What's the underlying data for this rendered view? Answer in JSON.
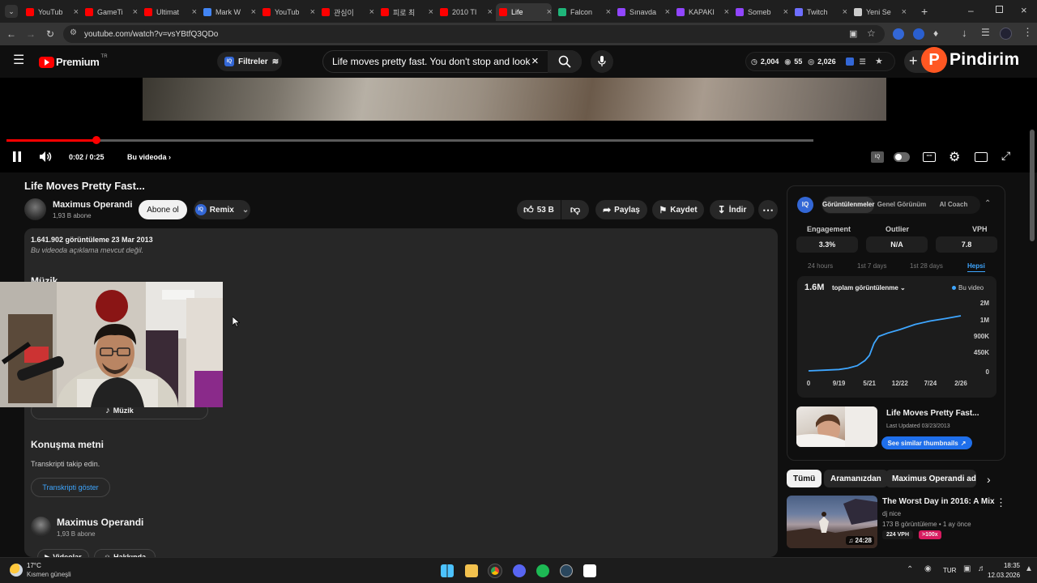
{
  "browser": {
    "tabs": [
      {
        "label": "YouTub",
        "color": "#ff0000"
      },
      {
        "label": "GameTi",
        "color": "#ff0000"
      },
      {
        "label": "Ultimat",
        "color": "#ff0000"
      },
      {
        "label": "Mark W",
        "color": "#4285f4"
      },
      {
        "label": "YouTub",
        "color": "#ff0000"
      },
      {
        "label": "관심이",
        "color": "#ff0000"
      },
      {
        "label": "피로 최",
        "color": "#ff0000"
      },
      {
        "label": "2010 TI",
        "color": "#ff0000"
      },
      {
        "label": "Life",
        "color": "#ff0000",
        "active": true
      },
      {
        "label": "Falcon",
        "color": "#1fb67a"
      },
      {
        "label": "Sınavda",
        "color": "#9146ff"
      },
      {
        "label": "KAPAKI",
        "color": "#9146ff"
      },
      {
        "label": "Someb",
        "color": "#9146ff"
      },
      {
        "label": "Twitch",
        "color": "#6e6eff"
      },
      {
        "label": "Yeni Se",
        "color": "#cccccc"
      }
    ],
    "url": "youtube.com/watch?v=vsYBtfQ3QDo"
  },
  "yt_header": {
    "logo": "Premium",
    "logo_region": "TR",
    "filters_label": "Filtreler",
    "search_value": "Life moves pretty fast. You don't stop and look aroun",
    "stats": [
      "2,004",
      "55",
      "2,026"
    ],
    "overlay_brand": "Pindirim"
  },
  "player": {
    "time": "0:02 / 0:25",
    "chapter": "Bu videoda",
    "progress_fraction": 0.111,
    "buffer_fraction": 1.0
  },
  "video": {
    "title": "Life Moves Pretty Fast...",
    "channel": "Maximus Operandi",
    "subscribers": "1,93 B abone",
    "subscribe_label": "Abone ol",
    "remix_label": "Remix",
    "likes": "53 B",
    "share_label": "Paylaş",
    "save_label": "Kaydet",
    "download_label": "İndir"
  },
  "description": {
    "views_date": "1.641.902 görüntüleme  23 Mar 2013",
    "no_desc": "Bu videoda açıklama mevcut değil.",
    "music_heading": "Müzik",
    "music_button": "Müzik",
    "transcript_heading": "Konuşma metni",
    "transcript_sub": "Transkripti takip edin.",
    "transcript_button": "Transkripti göster",
    "channel_name": "Maximus Operandi",
    "channel_subs": "1,93 B abone",
    "videos_button": "Videolar",
    "about_button": "Hakkında"
  },
  "iq_panel": {
    "tabs": [
      "Görüntülenmeler",
      "Genel Görünüm",
      "AI Coach"
    ],
    "stat_labels": [
      "Engagement",
      "Outlier",
      "VPH"
    ],
    "stat_values": [
      "3.3%",
      "N/A",
      "7.8"
    ],
    "ranges": [
      "24 hours",
      "1st 7 days",
      "1st 28 days",
      "Hepsi"
    ],
    "total": "1.6M",
    "metric_dropdown": "toplam görüntülenme",
    "legend": "Bu video",
    "related_title": "Life Moves Pretty Fast...",
    "related_updated": "Last Updated 03/23/2013",
    "similar_button": "See similar thumbnails"
  },
  "chart_data": {
    "type": "line",
    "x_tick_labels": [
      "0",
      "9/19",
      "5/21",
      "12/22",
      "7/24",
      "2/26"
    ],
    "y_tick_labels": [
      "2M",
      "1M",
      "900K",
      "450K",
      "0"
    ],
    "series": [
      {
        "name": "Bu video",
        "color": "#3ea6ff",
        "points": [
          [
            0,
            0
          ],
          [
            0.5,
            20000
          ],
          [
            1,
            40000
          ],
          [
            1.3,
            80000
          ],
          [
            1.6,
            150000
          ],
          [
            1.85,
            300000
          ],
          [
            2.0,
            450000
          ],
          [
            2.15,
            800000
          ],
          [
            2.3,
            1000000
          ],
          [
            2.6,
            1100000
          ],
          [
            3,
            1200000
          ],
          [
            3.5,
            1350000
          ],
          [
            4,
            1450000
          ],
          [
            4.5,
            1520000
          ],
          [
            5,
            1600000
          ]
        ]
      }
    ],
    "x_range": [
      0,
      5
    ]
  },
  "filter_chips": [
    "Tümü",
    "Aramanızdan",
    "Maximus Operandi adlı y"
  ],
  "recommendation": {
    "title": "The Worst Day in 2016: A Mix",
    "channel": "dj nice",
    "meta": "173 B görüntüleme • 1 ay önce",
    "vph": "224 VPH",
    "outlier": ">100x",
    "duration": "24:28"
  },
  "taskbar": {
    "weather_temp": "17°C",
    "weather_desc": "Kısmen güneşli",
    "lang": "TUR",
    "time": "18:35",
    "date": "12.03.2026"
  }
}
